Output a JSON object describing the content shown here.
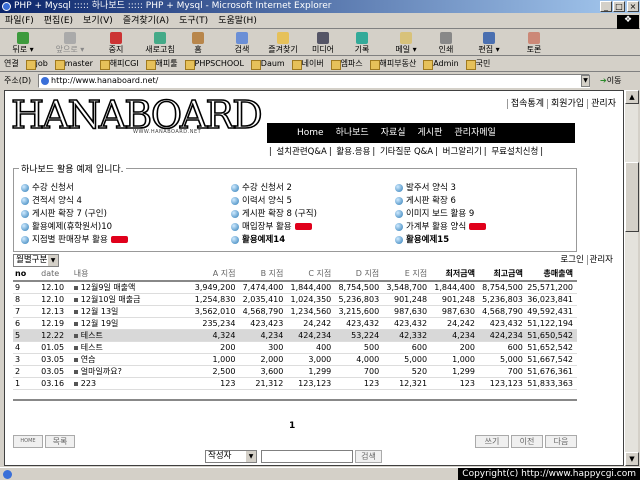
{
  "window": {
    "title": "PHP + Mysql ::::: 하나보드 ::::: PHP + Mysql - Microsoft Internet Explorer",
    "min": "_",
    "max": "□",
    "close": "×"
  },
  "menu": [
    "파일(F)",
    "편집(E)",
    "보기(V)",
    "즐겨찾기(A)",
    "도구(T)",
    "도움말(H)"
  ],
  "toolbar": {
    "back": "뒤로",
    "forward": "앞으로",
    "stop": "중지",
    "refresh": "새로고침",
    "home": "홈",
    "search": "검색",
    "favorites": "즐겨찾기",
    "media": "미디어",
    "history": "기록",
    "mail": "메일",
    "print": "인쇄",
    "edit": "편집",
    "discuss": "토론"
  },
  "links": {
    "label": "연결",
    "items": [
      "job",
      "master",
      "해피CGI",
      "해피툴",
      "PHPSCHOOL",
      "Daum",
      "네이버",
      "엠파스",
      "해피부동산",
      "Admin",
      "국민"
    ]
  },
  "address": {
    "label": "주소(D)",
    "url": "http://www.hanaboard.net/",
    "go": "이동"
  },
  "site": {
    "logo": "HANABOARD",
    "logo_sub": "WWW.HANABOARD.NET",
    "top_links": [
      "접속통계",
      "회원가입",
      "관리자"
    ],
    "nav": [
      "Home",
      "하나보드",
      "자료실",
      "게시판",
      "관리자메일"
    ],
    "subnav": [
      "설치관련Q&A",
      "활용.응용",
      "기타질문 Q&A",
      "버그알리기",
      "무료설치신청"
    ]
  },
  "examples": {
    "title": "하나보드 활용 예제 입니다.",
    "col1": [
      {
        "label": "수강 신청서"
      },
      {
        "label": "견적서 양식 4"
      },
      {
        "label": "게시판 확장 7 (구인)"
      },
      {
        "label": "활용예제(휴학원서)10"
      },
      {
        "label": "지점별 판매장부 활용",
        "new": true
      }
    ],
    "col2": [
      {
        "label": "수강 신청서 2"
      },
      {
        "label": "이력서 양식 5"
      },
      {
        "label": "게시판 확장 8 (구직)"
      },
      {
        "label": "매입장부 활용",
        "new": true
      },
      {
        "label": "활용예제14",
        "bold": true
      }
    ],
    "col3": [
      {
        "label": "발주서 양식 3"
      },
      {
        "label": "게시판 확장 6"
      },
      {
        "label": "이미지 보드 활용 9"
      },
      {
        "label": "가계부 활용 양식",
        "new": true
      },
      {
        "label": "활용예제15",
        "bold": true
      }
    ]
  },
  "board": {
    "month_select": "월별구분",
    "right_links": [
      "로그인",
      "관리자"
    ],
    "headers": [
      "no",
      "date",
      "내용",
      "A 지점",
      "B 지점",
      "C 지점",
      "D 지점",
      "E 지점",
      "최저금액",
      "최고금액",
      "총매출액"
    ],
    "rows": [
      [
        "9",
        "12.10",
        "12월9일 매출액",
        "3,949,200",
        "7,474,400",
        "1,844,400",
        "8,754,500",
        "3,548,700",
        "1,844,400",
        "8,754,500",
        "25,571,200"
      ],
      [
        "8",
        "12.10",
        "12월10일 매출금",
        "1,254,830",
        "2,035,410",
        "1,024,350",
        "5,236,803",
        "901,248",
        "901,248",
        "5,236,803",
        "36,023,841"
      ],
      [
        "7",
        "12.13",
        "12월 13일",
        "3,562,010",
        "4,568,790",
        "1,234,560",
        "3,215,600",
        "987,630",
        "987,630",
        "4,568,790",
        "49,592,431"
      ],
      [
        "6",
        "12.19",
        "12월 19일",
        "235,234",
        "423,423",
        "24,242",
        "423,432",
        "423,432",
        "24,242",
        "423,432",
        "51,122,194"
      ],
      [
        "5",
        "12.22",
        "테스트",
        "4,324",
        "4,234",
        "424,234",
        "53,224",
        "42,332",
        "4,234",
        "424,234",
        "51,650,542"
      ],
      [
        "4",
        "01.05",
        "테스트",
        "200",
        "300",
        "400",
        "500",
        "600",
        "200",
        "600",
        "51,652,542"
      ],
      [
        "3",
        "03.05",
        "연습",
        "1,000",
        "2,000",
        "3,000",
        "4,000",
        "5,000",
        "1,000",
        "5,000",
        "51,667,542"
      ],
      [
        "2",
        "03.05",
        "얼마일까요?",
        "2,500",
        "3,600",
        "1,299",
        "700",
        "520",
        "1,299",
        "700",
        "51,676,361"
      ],
      [
        "1",
        "03.16",
        "223",
        "123",
        "21,312",
        "123,123",
        "123",
        "12,321",
        "123",
        "123,123",
        "51,833,363"
      ]
    ],
    "highlight_row": 4,
    "page": "1",
    "home_btn": "HOME",
    "list_btn": "목록",
    "write_btn": "쓰기",
    "prev_btn": "이전",
    "next_btn": "다음",
    "search_field": "작성자",
    "search_btn": "검색"
  },
  "status": {
    "copyright": "Copyright(c) http://www.happycgi.com"
  },
  "colors": {
    "titlebar_start": "#0a246a",
    "nav_bg": "#000000",
    "new_badge": "#e0001b",
    "highlight_row": "#d8d8d8"
  }
}
